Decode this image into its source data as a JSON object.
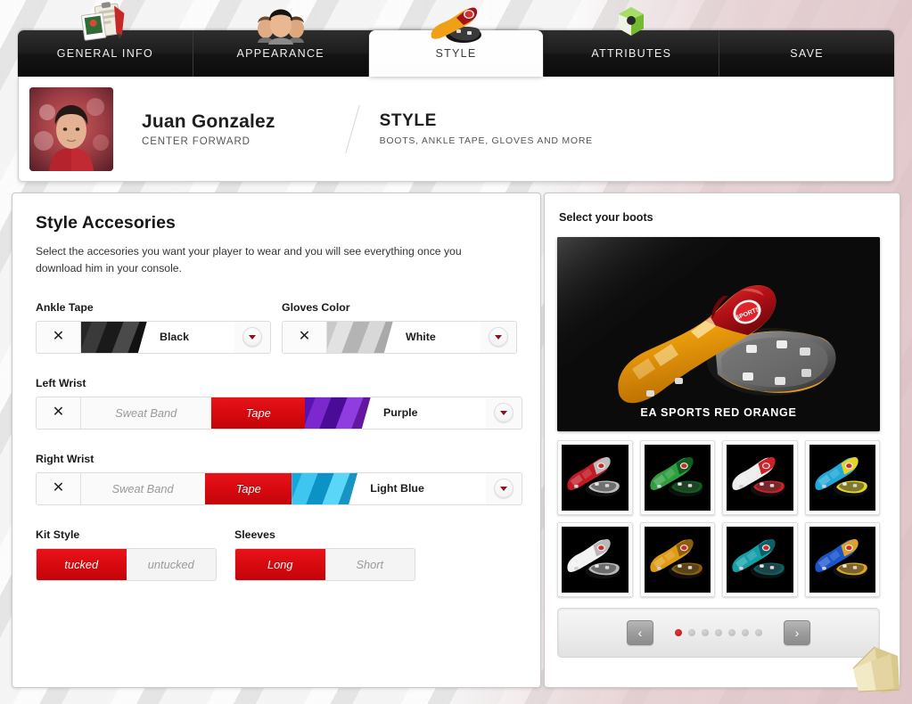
{
  "tabs": [
    {
      "label": "GENERAL INFO",
      "icon": "cards-clipboard-icon",
      "active": false
    },
    {
      "label": "APPEARANCE",
      "icon": "faces-icon",
      "active": false
    },
    {
      "label": "STYLE",
      "icon": "boots-icon",
      "active": true
    },
    {
      "label": "ATTRIBUTES",
      "icon": "green-ball-icon",
      "active": false
    },
    {
      "label": "SAVE",
      "icon": "",
      "active": false
    }
  ],
  "header": {
    "player_name": "Juan Gonzalez",
    "player_position": "CENTER FORWARD",
    "section_title": "STYLE",
    "section_subtitle": "BOOTS, ANKLE TAPE, GLOVES AND MORE",
    "avatar_name": "player-avatar"
  },
  "left_panel": {
    "title": "Style Accesories",
    "description": "Select the accesories you want your player to wear and you will see everything once you download him in your console.",
    "fields": [
      {
        "label": "Ankle Tape",
        "type": "color-select",
        "clear_label": "✕",
        "color_name": "Black",
        "swatch_colors": [
          "#272727",
          "#3a3a3a",
          "#1a1a1a",
          "#4a4a4a",
          "#121212"
        ]
      },
      {
        "label": "Gloves Color",
        "type": "color-select",
        "clear_label": "✕",
        "color_name": "White",
        "swatch_colors": [
          "#c9c9c9",
          "#e2e2e2",
          "#b4b4b4",
          "#d8d8d8",
          "#a9a9a9"
        ]
      },
      {
        "label": "Left Wrist",
        "type": "option-color-select",
        "clear_label": "✕",
        "options": [
          {
            "label": "Sweat Band",
            "selected": false
          },
          {
            "label": "Tape",
            "selected": true
          }
        ],
        "color_name": "Purple",
        "swatch_colors": [
          "#5b10b0",
          "#7b28cf",
          "#4a0c96",
          "#8f3ce0",
          "#63179f"
        ]
      },
      {
        "label": "Right Wrist",
        "type": "option-color-select",
        "clear_label": "✕",
        "options": [
          {
            "label": "Sweat Band",
            "selected": false
          },
          {
            "label": "Tape",
            "selected": true
          }
        ],
        "color_name": "Light Blue",
        "swatch_colors": [
          "#11a8dc",
          "#3fc6f0",
          "#0c93c6",
          "#5ad6f8",
          "#1794c2"
        ]
      }
    ],
    "toggles": [
      {
        "label": "Kit Style",
        "options": [
          {
            "label": "tucked",
            "selected": true
          },
          {
            "label": "untucked",
            "selected": false
          }
        ]
      },
      {
        "label": "Sleeves",
        "options": [
          {
            "label": "Long",
            "selected": true
          },
          {
            "label": "Short",
            "selected": false
          }
        ]
      }
    ]
  },
  "right_panel": {
    "title": "Select your boots",
    "hero_boot_name": "EA SPORTS RED ORANGE",
    "hero_brand_text": "SPORTS",
    "thumbnails": [
      {
        "name": "boot-red-grey",
        "selected": true,
        "primary": "#c21a25",
        "secondary": "#bdbdbd"
      },
      {
        "name": "boot-green",
        "selected": false,
        "primary": "#2f9e3e",
        "secondary": "#0f5e1e"
      },
      {
        "name": "boot-white-red",
        "selected": false,
        "primary": "#ededed",
        "secondary": "#cf2029"
      },
      {
        "name": "boot-cyan-yellow",
        "selected": false,
        "primary": "#22a8d6",
        "secondary": "#e3d42a"
      },
      {
        "name": "boot-white-silver",
        "selected": false,
        "primary": "#f2f2f2",
        "secondary": "#b9b9b9"
      },
      {
        "name": "boot-gold-orange",
        "selected": false,
        "primary": "#e09b15",
        "secondary": "#8d5e08"
      },
      {
        "name": "boot-teal",
        "selected": false,
        "primary": "#15a0a8",
        "secondary": "#0c5f66"
      },
      {
        "name": "boot-blue-gold",
        "selected": false,
        "primary": "#1b55c9",
        "secondary": "#d9a427"
      }
    ],
    "pager": {
      "prev_label": "‹",
      "next_label": "›",
      "dots": 7,
      "active_dot": 1
    }
  },
  "icons": {
    "clear": "close-x-icon",
    "dropdown": "chevron-down-icon",
    "prev": "chevron-left-icon",
    "next": "chevron-right-icon",
    "corner": "folded-paper-icon"
  },
  "colors": {
    "accent_red": "#d80a10",
    "tab_dark": "#1d1d1d",
    "panel_white": "#ffffff"
  }
}
